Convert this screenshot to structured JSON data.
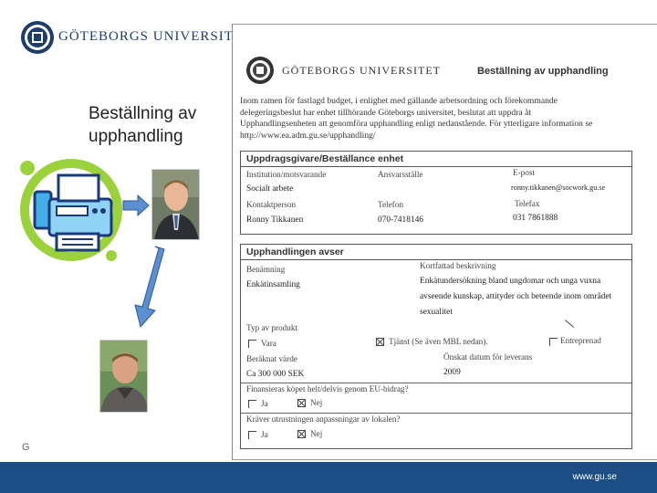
{
  "header": {
    "logo": "university-seal-icon",
    "title": "GÖTEBORGS UNIVERSITET"
  },
  "slide": {
    "title": "Beställning av\nupphandling"
  },
  "illustration": {
    "fax_icon": "fax-machine-icon",
    "arrow_right": "arrow-right-icon",
    "arrow_down": "arrow-down-icon",
    "photos": [
      "person-photo-1",
      "person-photo-2"
    ]
  },
  "footer": {
    "letter": "G",
    "url": "www.gu.se",
    "bar_color": "#1c4e85"
  },
  "document": {
    "university": "GÖTEBORGS UNIVERSITET",
    "heading": "Beställning av upphandling",
    "intro": [
      "Inom ramen för fastlagd budget, i enlighet med gällande arbetsordning och förekommande",
      "delegeringsbeslut har enhet tillhörande Göteborgs universitet, beslutat att uppdra åt",
      "Upphandlingsenheten att genomföra upphandling enligt nedanstående. För ytterligare information se",
      "http://www.ea.adm.gu.se/upphandling/"
    ],
    "section1": {
      "title": "Uppdragsgivare/Beställance enhet",
      "labels": {
        "institution": "Institution/motsvarande",
        "ansvar": "Ansvarsställe",
        "epost": "E-post",
        "socialt": "Socialt arbete",
        "kontakt": "Kontaktperson",
        "telefon": "Telefon",
        "telefax": "Telefax"
      },
      "values": {
        "epost": "ronny.tikkanen@socwork.gu.se",
        "kontakt": "Ronny Tikkanen",
        "telefon": "070-7418146",
        "telefax": "031 7861888"
      }
    },
    "section2": {
      "title": "Upphandlingen avser",
      "labels": {
        "benamning": "Benämning",
        "beskrivning": "Kortfattad beskrivning",
        "enkat": "Enkätinsamling",
        "beskrivning_text": [
          "Enkätundersökning bland ungdomar och unga vuxna",
          "avseende kunskap, attityder och beteende inom området",
          "sexualitet"
        ],
        "typ": "Typ av produkt",
        "vara": "Vara",
        "tjanst": "Tjänst (Se även MBL nedan).",
        "entreprenad": "Entreprenad",
        "berakn": "Beräknat värde",
        "datum": "Önskat datum för leverans",
        "berakn_val": "Ca 300 000 SEK",
        "datum_val": "2009",
        "eu": "Finansieras köpet helt/delvis genom EU-bidrag?",
        "ja": "Ja",
        "nej": "Nej",
        "lokal": "Kräver utrustningen anpassningar av lokalen?"
      },
      "checks": {
        "vara": false,
        "tjanst": true,
        "entreprenad": false,
        "eu_ja": false,
        "eu_nej": true,
        "lokal_ja": false,
        "lokal_nej": true
      }
    }
  }
}
